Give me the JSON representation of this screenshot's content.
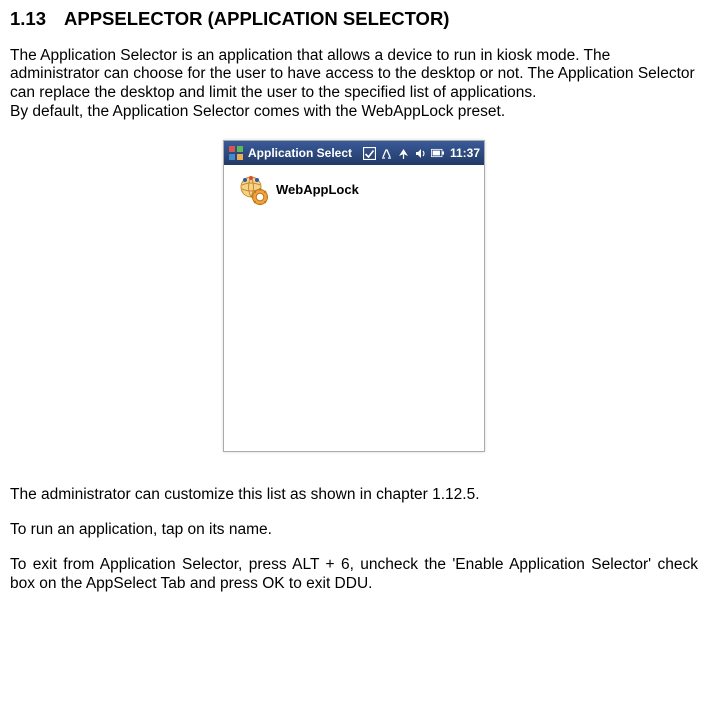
{
  "heading": {
    "number": "1.13",
    "title": "APPSELECTOR (APPLICATION SELECTOR)"
  },
  "body": {
    "p1": "The Application Selector is an application that allows a device to run in kiosk mode. The administrator can choose for the user to have access to the desktop or not. The Application Selector can replace the desktop and limit the user to the specified list of applications.",
    "p2": "By default, the Application Selector comes with the WebAppLock preset.",
    "p3": "The administrator can customize this list as shown in chapter 1.12.5.",
    "p4": "To run an application, tap on its name.",
    "p5": "To exit from Application Selector, press ALT + 6, uncheck the 'Enable Application Selector' check box on the AppSelect Tab and press OK to exit DDU."
  },
  "screenshot": {
    "titlebar": {
      "title": "Application Select",
      "clock": "11:37",
      "icons": {
        "start": "windows-start-icon",
        "ok": "ok-check-icon",
        "connect": "connectivity-icon",
        "signal": "signal-icon",
        "volume": "volume-icon",
        "battery": "battery-icon"
      }
    },
    "apps": [
      {
        "icon": "webapplock-icon",
        "name": "WebAppLock"
      }
    ]
  }
}
